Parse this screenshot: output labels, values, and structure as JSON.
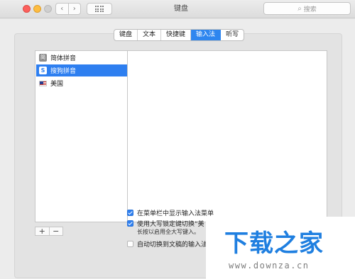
{
  "window": {
    "title": "键盘",
    "nav_back": "‹",
    "nav_forward": "›",
    "search_placeholder": "搜索",
    "search_icon": "magnifier-icon"
  },
  "tabs": [
    {
      "label": "键盘",
      "active": false
    },
    {
      "label": "文本",
      "active": false
    },
    {
      "label": "快捷键",
      "active": false
    },
    {
      "label": "输入法",
      "active": true
    },
    {
      "label": "听写",
      "active": false
    }
  ],
  "input_sources": [
    {
      "label": "简体拼音",
      "icon": "jianti-pinyin-icon",
      "selected": false
    },
    {
      "label": "搜狗拼音",
      "icon": "sogou-icon",
      "selected": true
    },
    {
      "label": "美国",
      "icon": "us-flag-icon",
      "selected": false
    }
  ],
  "list_buttons": {
    "add": "+",
    "remove": "−"
  },
  "options": [
    {
      "label": "在菜单栏中显示输入法菜单",
      "checked": true
    },
    {
      "label": "使用大写锁定键切换“美",
      "checked": true
    },
    {
      "label": "自动切换到文稿的输入法",
      "checked": false
    }
  ],
  "caps_note": "长按以启用全大写键入。",
  "watermark": {
    "title": "下载之家",
    "url": "www.downza.cn",
    "color": "#1f7fe0"
  },
  "colors": {
    "accent": "#2e7ff0",
    "close": "#fc605c",
    "minimize": "#fdbc40"
  }
}
